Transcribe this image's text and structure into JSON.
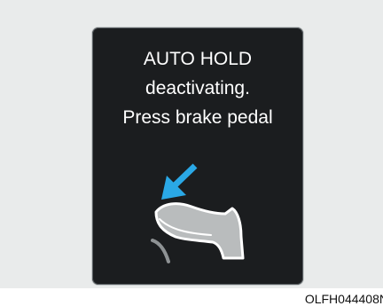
{
  "message": {
    "line1": "AUTO HOLD",
    "line2": "deactivating.",
    "line3": "Press brake pedal"
  },
  "icons": {
    "arrow": "down-left-arrow-icon",
    "foot": "foot-on-brake-pedal-icon"
  },
  "colors": {
    "panel": "#1b1d1f",
    "text": "#ffffff",
    "arrow": "#2aa8e6",
    "foot": "#b9bcbd",
    "backdrop": "#e9ebeb"
  },
  "figure_code": "OLFH044408N"
}
